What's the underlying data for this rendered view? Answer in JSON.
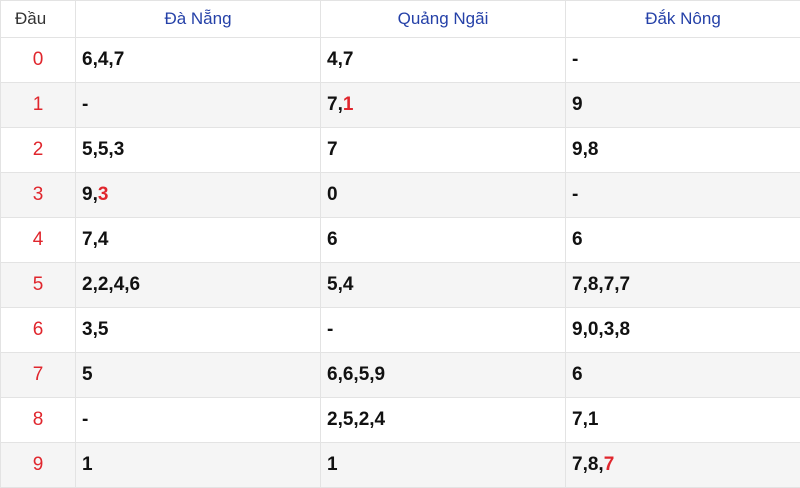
{
  "header": {
    "dau": "Đầu",
    "col1": "Đà Nẵng",
    "col2": "Quảng Ngãi",
    "col3": "Đắk Nông"
  },
  "rows": [
    {
      "dau": "0",
      "c1": [
        "6,4,7",
        ""
      ],
      "c2": [
        "4,7",
        ""
      ],
      "c3": [
        "-",
        ""
      ]
    },
    {
      "dau": "1",
      "c1": [
        "-",
        ""
      ],
      "c2": [
        "7,",
        "1"
      ],
      "c3": [
        "9",
        ""
      ]
    },
    {
      "dau": "2",
      "c1": [
        "5,5,3",
        ""
      ],
      "c2": [
        "7",
        ""
      ],
      "c3": [
        "9,8",
        ""
      ]
    },
    {
      "dau": "3",
      "c1": [
        "9,",
        "3"
      ],
      "c2": [
        "0",
        ""
      ],
      "c3": [
        "-",
        ""
      ]
    },
    {
      "dau": "4",
      "c1": [
        "7,4",
        ""
      ],
      "c2": [
        "6",
        ""
      ],
      "c3": [
        "6",
        ""
      ]
    },
    {
      "dau": "5",
      "c1": [
        "2,2,4,6",
        ""
      ],
      "c2": [
        "5,4",
        ""
      ],
      "c3": [
        "7,8,7,7",
        ""
      ]
    },
    {
      "dau": "6",
      "c1": [
        "3,5",
        ""
      ],
      "c2": [
        "-",
        ""
      ],
      "c3": [
        "9,0,3,8",
        ""
      ]
    },
    {
      "dau": "7",
      "c1": [
        "5",
        ""
      ],
      "c2": [
        "6,6,5,9",
        ""
      ],
      "c3": [
        "6",
        ""
      ]
    },
    {
      "dau": "8",
      "c1": [
        "-",
        ""
      ],
      "c2": [
        "2,5,2,4",
        ""
      ],
      "c3": [
        "7,1",
        ""
      ]
    },
    {
      "dau": "9",
      "c1": [
        "1",
        ""
      ],
      "c2": [
        "1",
        ""
      ],
      "c3": [
        "7,8,",
        "7"
      ]
    }
  ],
  "colors": {
    "header_text": "#2541a8",
    "highlight": "#e0262d",
    "row_alt": "#f5f5f5",
    "border": "#e3e3e3"
  }
}
